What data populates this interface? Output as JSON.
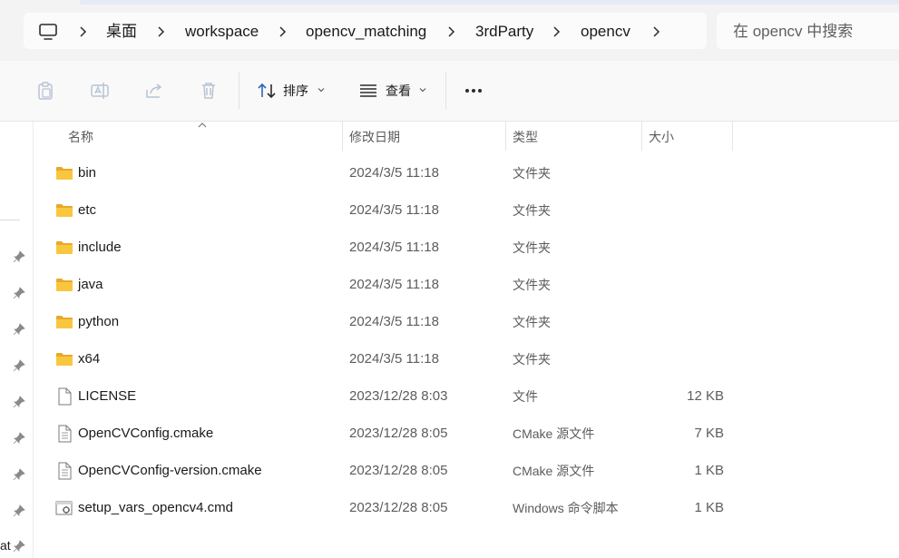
{
  "breadcrumb": {
    "items": [
      {
        "label": "桌面"
      },
      {
        "label": "workspace"
      },
      {
        "label": "opencv_matching"
      },
      {
        "label": "3rdParty"
      },
      {
        "label": "opencv"
      }
    ]
  },
  "search": {
    "placeholder": "在 opencv 中搜索"
  },
  "toolbar": {
    "sort_label": "排序",
    "view_label": "查看",
    "more_label": "•••"
  },
  "columns": {
    "name": "名称",
    "modified": "修改日期",
    "type": "类型",
    "size": "大小"
  },
  "files": [
    {
      "name": "bin",
      "modified": "2024/3/5 11:18",
      "type": "文件夹",
      "size": "",
      "icon": "folder-icon"
    },
    {
      "name": "etc",
      "modified": "2024/3/5 11:18",
      "type": "文件夹",
      "size": "",
      "icon": "folder-icon"
    },
    {
      "name": "include",
      "modified": "2024/3/5 11:18",
      "type": "文件夹",
      "size": "",
      "icon": "folder-icon"
    },
    {
      "name": "java",
      "modified": "2024/3/5 11:18",
      "type": "文件夹",
      "size": "",
      "icon": "folder-icon"
    },
    {
      "name": "python",
      "modified": "2024/3/5 11:18",
      "type": "文件夹",
      "size": "",
      "icon": "folder-icon"
    },
    {
      "name": "x64",
      "modified": "2024/3/5 11:18",
      "type": "文件夹",
      "size": "",
      "icon": "folder-icon"
    },
    {
      "name": "LICENSE",
      "modified": "2023/12/28 8:03",
      "type": "文件",
      "size": "12 KB",
      "icon": "blank-file-icon"
    },
    {
      "name": "OpenCVConfig.cmake",
      "modified": "2023/12/28 8:05",
      "type": "CMake 源文件",
      "size": "7 KB",
      "icon": "text-file-icon"
    },
    {
      "name": "OpenCVConfig-version.cmake",
      "modified": "2023/12/28 8:05",
      "type": "CMake 源文件",
      "size": "1 KB",
      "icon": "text-file-icon"
    },
    {
      "name": "setup_vars_opencv4.cmd",
      "modified": "2023/12/28 8:05",
      "type": "Windows 命令脚本",
      "size": "1 KB",
      "icon": "script-file-icon"
    }
  ],
  "nav_pane": {
    "fragment_text": "at"
  },
  "colors": {
    "folder": "#f8c73d",
    "folder_dark": "#e8a928",
    "accent_blue": "#2a66b8"
  }
}
